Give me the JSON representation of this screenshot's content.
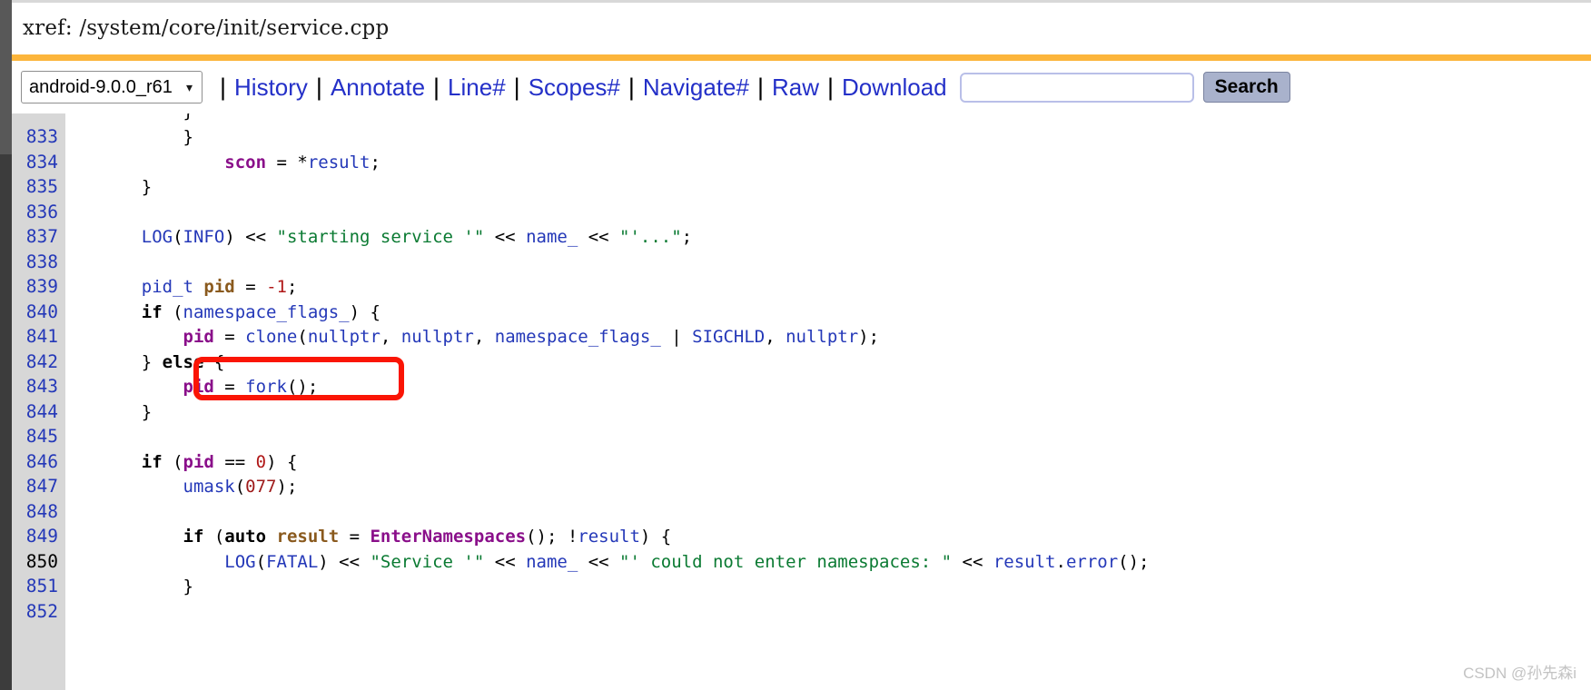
{
  "window": {
    "xref_title": "xref: /system/core/init/service.cpp"
  },
  "navbar": {
    "version_selected": "android-9.0.0_r61",
    "version_options": [
      "android-9.0.0_r61"
    ],
    "chevron_icon": "chevron-down-icon",
    "separator": "|",
    "links": [
      {
        "label": "History"
      },
      {
        "label": "Annotate"
      },
      {
        "label": "Line#"
      },
      {
        "label": "Scopes#"
      },
      {
        "label": "Navigate#"
      },
      {
        "label": "Raw"
      },
      {
        "label": "Download"
      }
    ],
    "search": {
      "value": "",
      "placeholder": "",
      "button_label": "Search"
    }
  },
  "code": {
    "current_line": "850",
    "clipped_top_line": "        }",
    "lines": [
      {
        "no": "833",
        "tokens": [
          {
            "t": "        }",
            "c": "t-punc"
          }
        ]
      },
      {
        "no": "834",
        "tokens": [
          {
            "t": "            ",
            "c": "t-punc"
          },
          {
            "t": "scon",
            "c": "t-var"
          },
          {
            "t": " = ",
            "c": "t-punc"
          },
          {
            "t": "*",
            "c": "t-punc"
          },
          {
            "t": "result",
            "c": "t-id"
          },
          {
            "t": ";",
            "c": "t-punc"
          }
        ]
      },
      {
        "no": "835",
        "tokens": [
          {
            "t": "    }",
            "c": "t-punc"
          }
        ]
      },
      {
        "no": "836",
        "tokens": [
          {
            "t": "",
            "c": "t-punc"
          }
        ]
      },
      {
        "no": "837",
        "tokens": [
          {
            "t": "    ",
            "c": "t-punc"
          },
          {
            "t": "LOG",
            "c": "t-fn"
          },
          {
            "t": "(",
            "c": "t-punc"
          },
          {
            "t": "INFO",
            "c": "t-fn"
          },
          {
            "t": ") << ",
            "c": "t-punc"
          },
          {
            "t": "\"starting service '\"",
            "c": "t-str"
          },
          {
            "t": " << ",
            "c": "t-punc"
          },
          {
            "t": "name_",
            "c": "t-id"
          },
          {
            "t": " << ",
            "c": "t-punc"
          },
          {
            "t": "\"'...\"",
            "c": "t-str"
          },
          {
            "t": ";",
            "c": "t-punc"
          }
        ]
      },
      {
        "no": "838",
        "tokens": [
          {
            "t": "",
            "c": "t-punc"
          }
        ]
      },
      {
        "no": "839",
        "tokens": [
          {
            "t": "    ",
            "c": "t-punc"
          },
          {
            "t": "pid_t",
            "c": "t-id"
          },
          {
            "t": " ",
            "c": "t-punc"
          },
          {
            "t": "pid",
            "c": "t-var2"
          },
          {
            "t": " = ",
            "c": "t-punc"
          },
          {
            "t": "-1",
            "c": "t-num"
          },
          {
            "t": ";",
            "c": "t-punc"
          }
        ]
      },
      {
        "no": "840",
        "tokens": [
          {
            "t": "    ",
            "c": "t-punc"
          },
          {
            "t": "if",
            "c": "t-kw"
          },
          {
            "t": " (",
            "c": "t-punc"
          },
          {
            "t": "namespace_flags_",
            "c": "t-id"
          },
          {
            "t": ") {",
            "c": "t-punc"
          }
        ]
      },
      {
        "no": "841",
        "tokens": [
          {
            "t": "        ",
            "c": "t-punc"
          },
          {
            "t": "pid",
            "c": "t-var"
          },
          {
            "t": " = ",
            "c": "t-punc"
          },
          {
            "t": "clone",
            "c": "t-fn"
          },
          {
            "t": "(",
            "c": "t-punc"
          },
          {
            "t": "nullptr",
            "c": "t-id"
          },
          {
            "t": ", ",
            "c": "t-punc"
          },
          {
            "t": "nullptr",
            "c": "t-id"
          },
          {
            "t": ", ",
            "c": "t-punc"
          },
          {
            "t": "namespace_flags_",
            "c": "t-id"
          },
          {
            "t": " | ",
            "c": "t-punc"
          },
          {
            "t": "SIGCHLD",
            "c": "t-id"
          },
          {
            "t": ", ",
            "c": "t-punc"
          },
          {
            "t": "nullptr",
            "c": "t-id"
          },
          {
            "t": ");",
            "c": "t-punc"
          }
        ]
      },
      {
        "no": "842",
        "tokens": [
          {
            "t": "    } ",
            "c": "t-punc"
          },
          {
            "t": "else",
            "c": "t-kw"
          },
          {
            "t": " {",
            "c": "t-punc"
          }
        ]
      },
      {
        "no": "843",
        "tokens": [
          {
            "t": "        ",
            "c": "t-punc"
          },
          {
            "t": "pid",
            "c": "t-var"
          },
          {
            "t": " = ",
            "c": "t-punc"
          },
          {
            "t": "fork",
            "c": "t-fn"
          },
          {
            "t": "();",
            "c": "t-punc"
          }
        ]
      },
      {
        "no": "844",
        "tokens": [
          {
            "t": "    }",
            "c": "t-punc"
          }
        ]
      },
      {
        "no": "845",
        "tokens": [
          {
            "t": "",
            "c": "t-punc"
          }
        ]
      },
      {
        "no": "846",
        "tokens": [
          {
            "t": "    ",
            "c": "t-punc"
          },
          {
            "t": "if",
            "c": "t-kw"
          },
          {
            "t": " (",
            "c": "t-punc"
          },
          {
            "t": "pid",
            "c": "t-var"
          },
          {
            "t": " == ",
            "c": "t-punc"
          },
          {
            "t": "0",
            "c": "t-num"
          },
          {
            "t": ") {",
            "c": "t-punc"
          }
        ]
      },
      {
        "no": "847",
        "tokens": [
          {
            "t": "        ",
            "c": "t-punc"
          },
          {
            "t": "umask",
            "c": "t-fn"
          },
          {
            "t": "(",
            "c": "t-punc"
          },
          {
            "t": "077",
            "c": "t-num2"
          },
          {
            "t": ");",
            "c": "t-punc"
          }
        ]
      },
      {
        "no": "848",
        "tokens": [
          {
            "t": "",
            "c": "t-punc"
          }
        ]
      },
      {
        "no": "849",
        "tokens": [
          {
            "t": "        ",
            "c": "t-punc"
          },
          {
            "t": "if",
            "c": "t-kw"
          },
          {
            "t": " (",
            "c": "t-punc"
          },
          {
            "t": "auto",
            "c": "t-kw"
          },
          {
            "t": " ",
            "c": "t-punc"
          },
          {
            "t": "result",
            "c": "t-var2"
          },
          {
            "t": " = ",
            "c": "t-punc"
          },
          {
            "t": "EnterNamespaces",
            "c": "t-fnb"
          },
          {
            "t": "(); !",
            "c": "t-punc"
          },
          {
            "t": "result",
            "c": "t-id"
          },
          {
            "t": ") {",
            "c": "t-punc"
          }
        ]
      },
      {
        "no": "850",
        "tokens": [
          {
            "t": "            ",
            "c": "t-punc"
          },
          {
            "t": "LOG",
            "c": "t-fn"
          },
          {
            "t": "(",
            "c": "t-punc"
          },
          {
            "t": "FATAL",
            "c": "t-fn"
          },
          {
            "t": ") << ",
            "c": "t-punc"
          },
          {
            "t": "\"Service '\"",
            "c": "t-str"
          },
          {
            "t": " << ",
            "c": "t-punc"
          },
          {
            "t": "name_",
            "c": "t-id"
          },
          {
            "t": " << ",
            "c": "t-punc"
          },
          {
            "t": "\"' could not enter namespaces: \"",
            "c": "t-str"
          },
          {
            "t": " << ",
            "c": "t-punc"
          },
          {
            "t": "result",
            "c": "t-id"
          },
          {
            "t": ".",
            "c": "t-punc"
          },
          {
            "t": "error",
            "c": "t-fn"
          },
          {
            "t": "();",
            "c": "t-punc"
          }
        ]
      },
      {
        "no": "851",
        "tokens": [
          {
            "t": "        }",
            "c": "t-punc"
          }
        ]
      },
      {
        "no": "852",
        "tokens": [
          {
            "t": "",
            "c": "t-punc"
          }
        ]
      }
    ]
  },
  "annotation": {
    "highlight_box_color": "#fa1505",
    "highlight_target_line": "843"
  },
  "watermark": {
    "text": "CSDN @孙先森i"
  }
}
